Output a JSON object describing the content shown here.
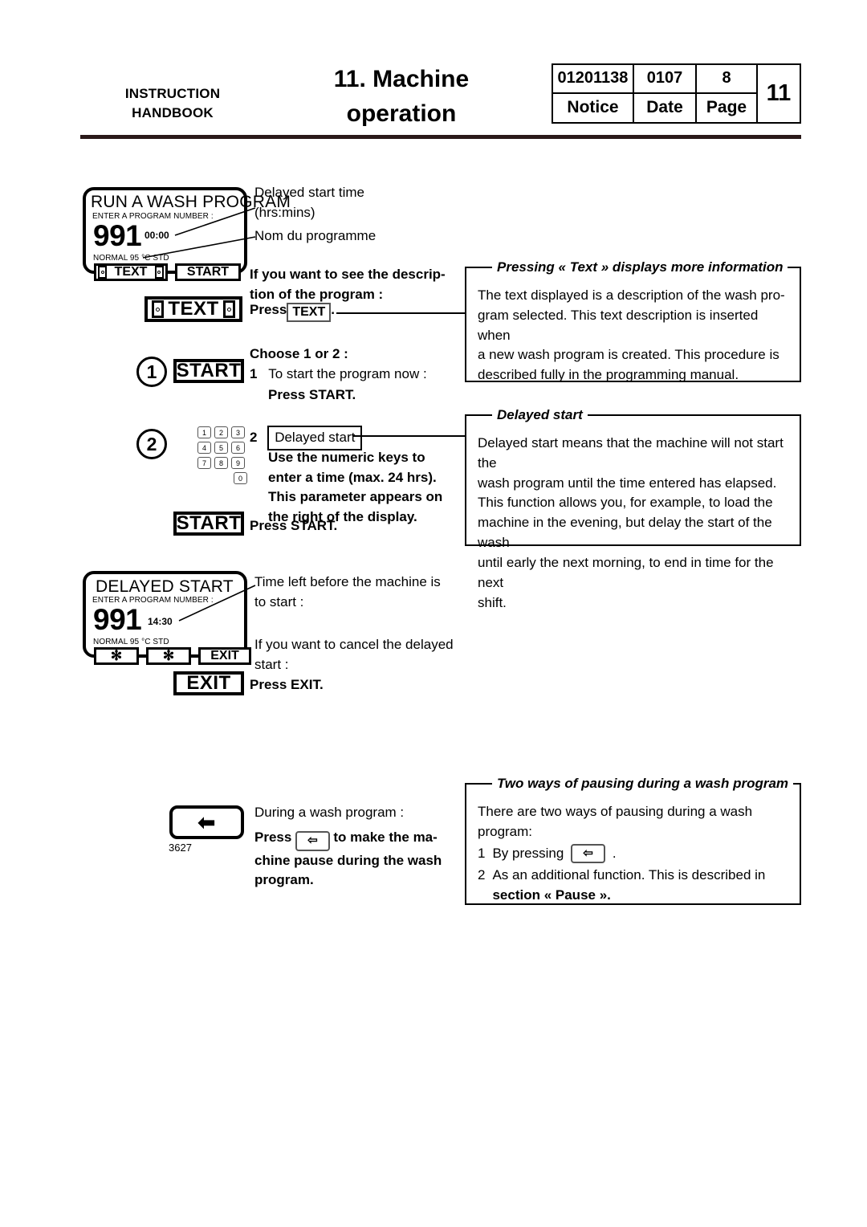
{
  "header": {
    "left_line1": "INSTRUCTION",
    "left_line2": "HANDBOOK",
    "title_line1": "11. Machine",
    "title_line2": "operation",
    "table": {
      "notice_value": "01201138",
      "date_value": "0107",
      "page_value": "8",
      "notice_label": "Notice",
      "date_label": "Date",
      "page_label": "Page",
      "chapter_number": "11"
    }
  },
  "display_run": {
    "title": "RUN A WASH PROGRAM",
    "subtitle": "ENTER A PROGRAM NUMBER :",
    "program_number": "991",
    "time": "00:00",
    "program_name": "NORMAL 95 °C STD",
    "button_text": "TEXT",
    "button_start": "START"
  },
  "display_run_labels": {
    "time_label_line1": "Delayed start time",
    "time_label_line2": "(hrs:mins)",
    "program_label": "Nom du programme"
  },
  "display_delayed": {
    "title": "DELAYED START",
    "subtitle": "ENTER A PROGRAM NUMBER :",
    "program_number": "991",
    "time": "14:30",
    "program_name": "NORMAL 95 °C STD",
    "button_star1": "✻",
    "button_star2": "✻",
    "button_exit": "EXIT"
  },
  "display_delayed_labels": {
    "time_label_line1": "Time left before the machine is",
    "time_label_line2": "to start :",
    "cancel_line1": "If you want to cancel the delayed",
    "cancel_line2": "start :",
    "cancel_action": "Press  EXIT."
  },
  "step_text": {
    "heading_line1": "If you want to see the descrip-",
    "heading_line2": "tion of the program :",
    "action_prefix": "Press",
    "action_button": "TEXT",
    "action_suffix": ".",
    "button_label": "TEXT"
  },
  "step_choose": {
    "heading": "Choose 1 or 2 :",
    "option1_number": "1",
    "option1_text": "To start the program now :",
    "option1_action": "Press START.",
    "button_start": "START",
    "circle1": "1"
  },
  "step_delayed": {
    "circle2": "2",
    "option2_number": "2",
    "option2_label": "Delayed start",
    "body_line1": "Use the numeric keys to",
    "body_line2": "enter a time (max. 24 hrs).",
    "body_line3": "This parameter appears on",
    "body_line4": "the right of the display.",
    "action": "Press START.",
    "button_start": "START",
    "keypad": [
      [
        "1",
        "2",
        "3"
      ],
      [
        "4",
        "5",
        "6"
      ],
      [
        "7",
        "8",
        "9"
      ],
      [
        "0"
      ]
    ]
  },
  "step_exit": {
    "button_exit": "EXIT"
  },
  "step_pause": {
    "button_arrow": "⬅",
    "figure_number": "3627",
    "intro": "During a wash program :",
    "action_prefix": "Press",
    "action_button": "⇦",
    "action_line1_suffix": "to make the ma-",
    "action_line2": "chine pause during the wash",
    "action_line3": "program."
  },
  "callout_text": {
    "legend": "Pressing « Text » displays more information",
    "line1": "The text displayed is a description of the wash pro-",
    "line2": "gram selected. This text description is inserted when",
    "line3": "a new wash program is created. This procedure is",
    "line4": "described fully in the programming manual."
  },
  "callout_delayed": {
    "legend": "Delayed start",
    "line1": "Delayed start means that the machine will not start the",
    "line2": "wash program until the time entered has elapsed.",
    "line3": "This function allows you, for example, to load the",
    "line4": "machine in the evening, but delay the start of the wash",
    "line5": "until early the next morning, to end in time for the next",
    "line6": "shift."
  },
  "callout_pause": {
    "legend": "Two ways of pausing during a wash program",
    "intro": "There are two ways of pausing during a wash program:",
    "item1_number": "1",
    "item1_prefix": "By pressing",
    "item1_button": "⇦",
    "item1_suffix": ".",
    "item2_number": "2",
    "item2_line1": "As an additional function. This is described in",
    "item2_line2": "section « Pause »."
  }
}
